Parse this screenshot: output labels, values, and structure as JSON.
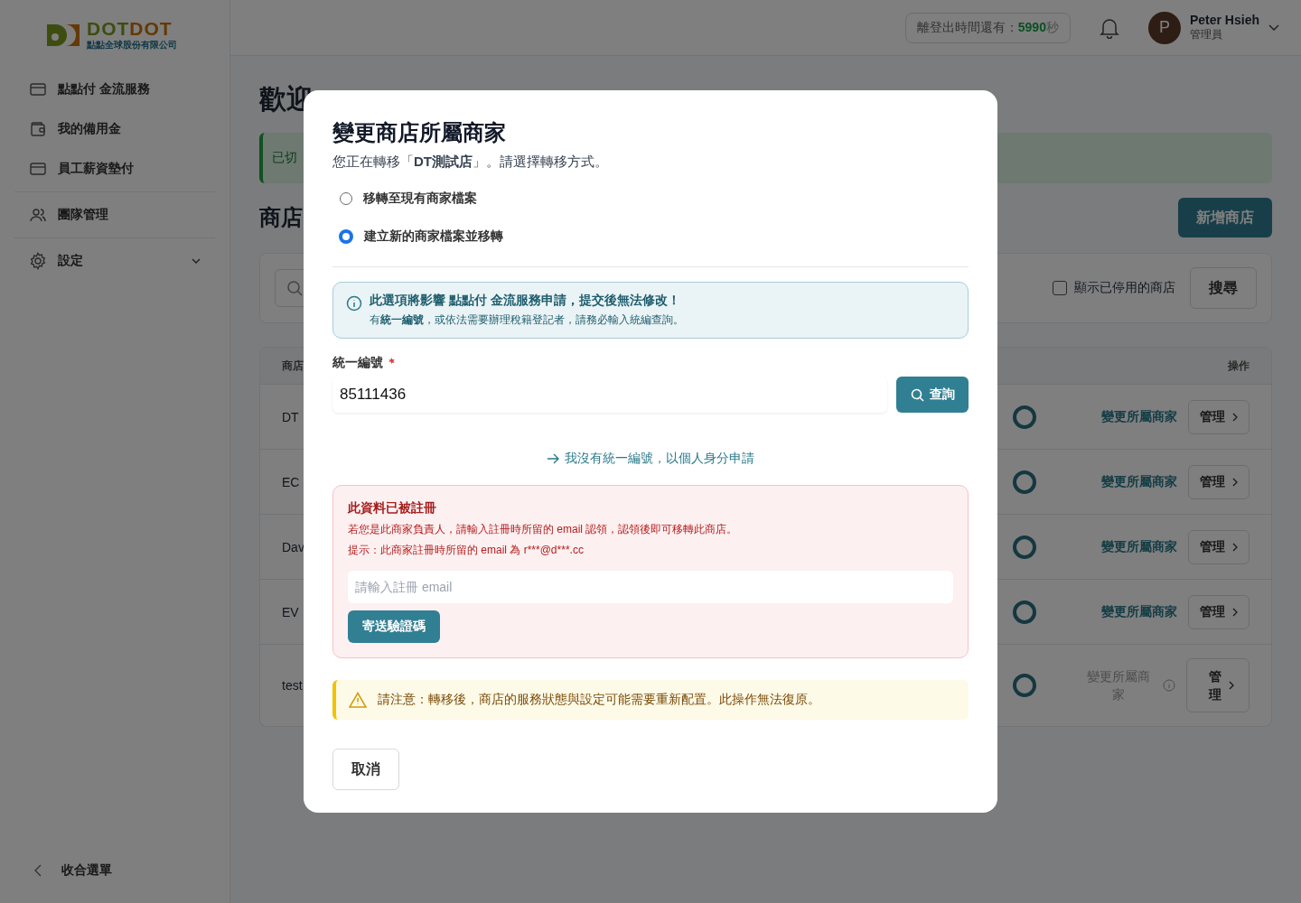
{
  "sidebar": {
    "logo": {
      "wordmark": [
        "DOT",
        "DOT"
      ],
      "subtitle": "點點全球股份有限公司"
    },
    "groups": [
      [
        {
          "label": "點點付 金流服務",
          "kind": "card"
        },
        {
          "label": "我的備用金",
          "kind": "wallet"
        },
        {
          "label": "員工薪資墊付",
          "kind": "card"
        }
      ],
      [
        {
          "label": "團隊管理",
          "kind": "team"
        }
      ],
      [
        {
          "label": "設定",
          "kind": "gear",
          "expanded": false
        }
      ]
    ],
    "collapse": "收合選單"
  },
  "header": {
    "session": {
      "label": "離登出時間還有：",
      "count": "5990",
      "unit": "秒"
    },
    "user": {
      "initial": "P",
      "name": "Peter Hsieh",
      "role": "管理員"
    }
  },
  "main": {
    "title": "歡迎",
    "notice": "已切",
    "section_title": "商店",
    "add_button": "新增商店",
    "filter": {
      "show_disabled": {
        "label": "顯示已停用的商店",
        "checked": false
      },
      "search_button": "搜尋"
    },
    "table": {
      "columns": [
        "商店",
        "操作"
      ],
      "rows": [
        {
          "name": "DT",
          "link": "變更所屬商家",
          "link_disabled": false,
          "manage": "管理"
        },
        {
          "name": "EC",
          "link": "變更所屬商家",
          "link_disabled": false,
          "manage": "管理"
        },
        {
          "name": "Dav",
          "link": "變更所屬商家",
          "link_disabled": false,
          "manage": "管理"
        },
        {
          "name": "EV",
          "link": "變更所屬商家",
          "link_disabled": false,
          "manage": "管理"
        },
        {
          "name": "test",
          "link": "變更所屬商家",
          "link_disabled": true,
          "manage": "管理"
        }
      ]
    }
  },
  "modal": {
    "title": "變更商店所屬商家",
    "subtitle": "您正在轉移「**DT測試店**」。請選擇轉移方式。",
    "options": [
      {
        "label": "移轉至現有商家檔案",
        "selected": false
      },
      {
        "label": "建立新的商家檔案並移轉",
        "selected": true
      }
    ],
    "info": {
      "title": "此選項將影響 點點付 金流服務申請，提交後無法修改！",
      "body": "有**統一編號**，或依法需要辦理稅籍登記者，請務必輸入統編查詢。"
    },
    "tax_id": {
      "label": "統一編號",
      "required": true,
      "value": "85111436",
      "button": "查詢"
    },
    "personal_link": "我沒有統一編號，以個人身分申請",
    "error": {
      "title": "此資料已被註冊",
      "lines": [
        "若您是此商家負責人，請輸入註冊時所留的 email 認領，認領後即可移轉此商店。",
        "提示：此商家註冊時所留的 email 為 r***@d***.cc"
      ],
      "email_placeholder": "請輸入註冊 email",
      "button": "寄送驗證碼"
    },
    "warning": "請注意：轉移後，商店的服務狀態與設定可能需要重新配置。此操作無法復原。",
    "cancel": "取消"
  }
}
